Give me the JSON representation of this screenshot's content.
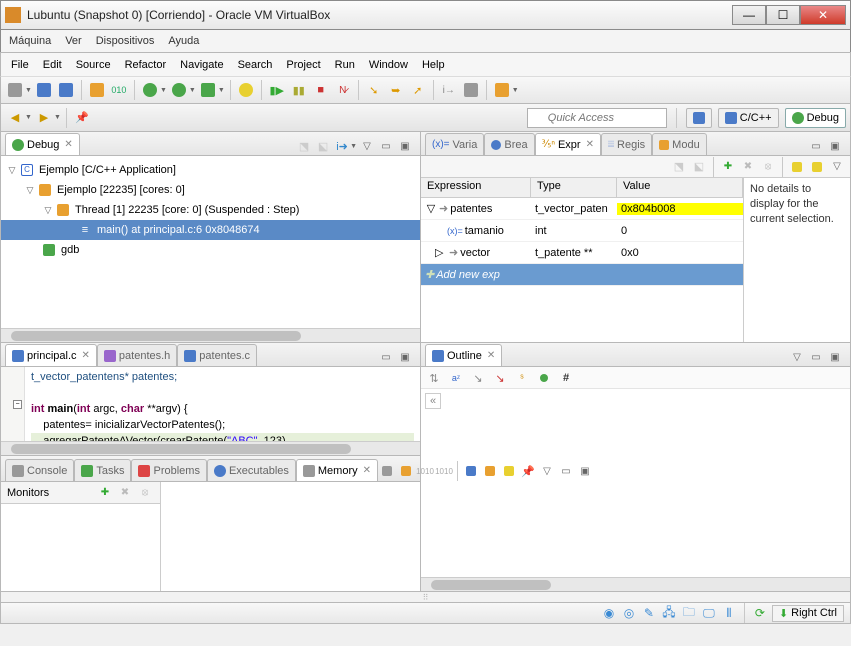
{
  "window": {
    "title": "Lubuntu (Snapshot 0) [Corriendo] - Oracle VM VirtualBox"
  },
  "vmmenu": {
    "maquina": "Máquina",
    "ver": "Ver",
    "dispositivos": "Dispositivos",
    "ayuda": "Ayuda"
  },
  "eclmenu": {
    "file": "File",
    "edit": "Edit",
    "source": "Source",
    "refactor": "Refactor",
    "navigate": "Navigate",
    "search": "Search",
    "project": "Project",
    "run": "Run",
    "window": "Window",
    "help": "Help"
  },
  "quickaccess": {
    "placeholder": "Quick Access"
  },
  "perspectives": {
    "ccpp": "C/C++",
    "debug": "Debug"
  },
  "debug_view": {
    "label": "Debug",
    "rows": [
      {
        "indent": 0,
        "icon": "c-app",
        "text": "Ejemplo [C/C++ Application]"
      },
      {
        "indent": 1,
        "icon": "process",
        "text": "Ejemplo [22235] [cores: 0]"
      },
      {
        "indent": 2,
        "icon": "thread",
        "text": "Thread [1] 22235 [core: 0] (Suspended : Step)"
      },
      {
        "indent": 3,
        "icon": "frame",
        "text": "main() at principal.c:6 0x8048674",
        "selected": true
      },
      {
        "indent": 1,
        "icon": "gdb",
        "text": "gdb"
      }
    ]
  },
  "vars_tabs": {
    "varia": "Varia",
    "brea": "Brea",
    "expr": "Expr",
    "regis": "Regis",
    "modu": "Modu"
  },
  "expr_view": {
    "cols": {
      "name": "Expression",
      "type": "Type",
      "value": "Value"
    },
    "rows": [
      {
        "name": "patentes",
        "type": "t_vector_paten",
        "value": "0x804b008",
        "hl": true,
        "expander": "▽"
      },
      {
        "name": "tamanio",
        "type": "int",
        "value": "0",
        "icon": "(x)="
      },
      {
        "name": "vector",
        "type": "t_patente **",
        "value": "0x0",
        "expander": "▷"
      }
    ],
    "addnew": "Add new exp",
    "detail": "No details to display for the current selection."
  },
  "editor": {
    "tabs": {
      "principal": "principal.c",
      "patentesh": "patentes.h",
      "patentesc": "patentes.c"
    },
    "lines": [
      {
        "raw": "t_vector_patentens* patentes;"
      },
      {
        "raw": ""
      },
      {
        "raw": "int main(int argc, char **argv) {"
      },
      {
        "raw": "    patentes= inicializarVectorPatentes();"
      },
      {
        "raw": "    agregarPatenteAVector(crearPatente(\"ABC\", 123)"
      }
    ]
  },
  "outline": {
    "label": "Outline"
  },
  "bottom_tabs": {
    "console": "Console",
    "tasks": "Tasks",
    "problems": "Problems",
    "executables": "Executables",
    "memory": "Memory"
  },
  "memory": {
    "monitors": "Monitors"
  },
  "status": {
    "hostkey": "Right Ctrl"
  }
}
